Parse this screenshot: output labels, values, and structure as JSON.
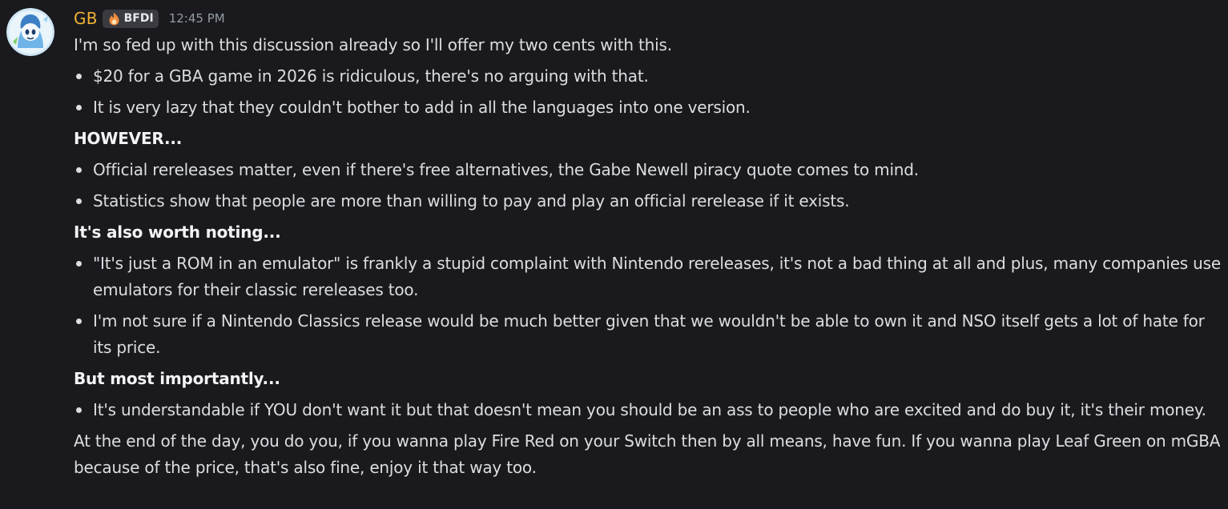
{
  "author": {
    "username": "GB",
    "tag": "BFDI",
    "tag_icon": "fire-icon",
    "timestamp": "12:45 PM",
    "avatar": "avatar",
    "name_color": "#f0b232"
  },
  "message": {
    "intro": "I'm so fed up with this discussion already so I'll offer my two cents with this.",
    "list1": [
      "$20 for a GBA game in 2026 is ridiculous, there's no arguing with that.",
      "It is very lazy that they couldn't bother to add in all the languages into one version."
    ],
    "heading1": "HOWEVER...",
    "list2": [
      "Official rereleases matter, even if there's free alternatives, the Gabe Newell piracy quote comes to mind.",
      "Statistics show that people are more than willing to pay and play an official rerelease if it exists."
    ],
    "heading2": "It's also worth noting...",
    "list3": [
      "\"It's just a ROM in an emulator\" is frankly a stupid complaint with Nintendo rereleases, it's not a bad thing at all and plus, many companies use emulators for their classic rereleases too.",
      "I'm not sure if a Nintendo Classics release would be much better given that we wouldn't be able to own it and NSO itself gets a lot of hate for its price."
    ],
    "heading3": "But most importantly...",
    "list4": [
      "It's understandable if YOU don't want it but that doesn't mean you should be an ass to people who are excited and do buy it, it's their money."
    ],
    "outro": "At the end of the day, you do you, if you wanna play Fire Red on your Switch then by all means, have fun. If you wanna play Leaf Green on mGBA because of the price, that's also fine, enjoy it that way too."
  },
  "colors": {
    "background": "#1a1a1e",
    "text": "#dbdee1",
    "timestamp": "#949ba4",
    "tag_bg": "#3a3b41"
  }
}
